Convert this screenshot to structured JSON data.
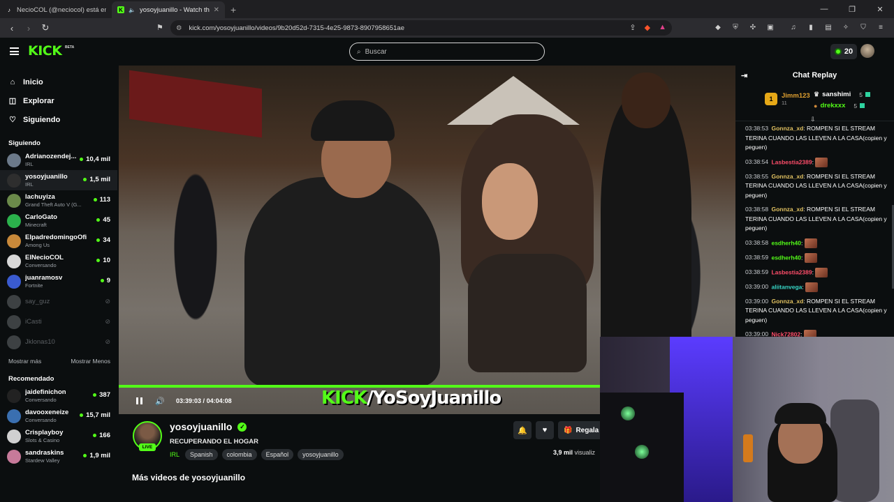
{
  "browser": {
    "tabs": [
      {
        "title": "NecioCOL (@neciocol) está emitiendo",
        "active": false
      },
      {
        "title": "yosoyjuanillo - Watch the VOD",
        "active": true
      }
    ],
    "url": "kick.com/yosoyjuanillo/videos/9b20d52d-7315-4e25-9873-8907958651ae"
  },
  "header": {
    "logo": "KICK",
    "beta": "BETA",
    "search_placeholder": "Buscar",
    "kicks_count": "20"
  },
  "nav": {
    "items": [
      {
        "label": "Inicio",
        "icon": "home-icon"
      },
      {
        "label": "Explorar",
        "icon": "compass-icon"
      },
      {
        "label": "Siguiendo",
        "icon": "heart-icon"
      }
    ]
  },
  "following": {
    "title": "Siguiendo",
    "channels": [
      {
        "name": "Adrianozendej...",
        "category": "IRL",
        "viewers": "10,4 mil",
        "live": true,
        "color": "#6c7a8a"
      },
      {
        "name": "yosoyjuanillo",
        "category": "IRL",
        "viewers": "1,5 mil",
        "live": true,
        "color": "#2e2e2e"
      },
      {
        "name": "lachuyiza",
        "category": "Grand Theft Auto V (G...",
        "viewers": "113",
        "live": true,
        "color": "#6b8a4a"
      },
      {
        "name": "CarloGato",
        "category": "Minecraft",
        "viewers": "45",
        "live": true,
        "color": "#2bb24c"
      },
      {
        "name": "ElpadredomingoOfi...",
        "category": "Among Us",
        "viewers": "34",
        "live": true,
        "color": "#c8893a"
      },
      {
        "name": "ElNecioCOL",
        "category": "Conversando",
        "viewers": "10",
        "live": true,
        "color": "#d8d8d8"
      },
      {
        "name": "juanramosv",
        "category": "Fortnite",
        "viewers": "9",
        "live": true,
        "color": "#3a5bd0"
      },
      {
        "name": "say_guz",
        "category": "",
        "viewers": "",
        "live": false,
        "color": "#9aa0a6"
      },
      {
        "name": "iCasti",
        "category": "",
        "viewers": "",
        "live": false,
        "color": "#9aa0a6"
      },
      {
        "name": "Jklonas10",
        "category": "",
        "viewers": "",
        "live": false,
        "color": "#9aa0a6"
      }
    ],
    "show_more": "Mostrar más",
    "show_less": "Mostrar Menos"
  },
  "recommended": {
    "title": "Recomendado",
    "channels": [
      {
        "name": "jaidefinichon",
        "category": "Conversando",
        "viewers": "387",
        "color": "#222"
      },
      {
        "name": "davooxeneize",
        "category": "Conversando",
        "viewers": "15,7 mil",
        "color": "#3a6fb0"
      },
      {
        "name": "Crisplayboy",
        "category": "Slots & Casino",
        "viewers": "166",
        "color": "#d0d0d0"
      },
      {
        "name": "sandraskins",
        "category": "Stardew Valley",
        "viewers": "1,9 mil",
        "color": "#c77a9a"
      }
    ]
  },
  "player": {
    "watermark_kick": "KICK",
    "watermark_name": "/YoSoyJuanillo",
    "current_time": "03:39:03",
    "separator": "/",
    "duration": "04:04:08",
    "progress": 0.8334
  },
  "channel": {
    "username": "yosoyjuanillo",
    "live_badge": "LIVE",
    "stream_title": "RECUPERANDO EL HOGAR",
    "category": "IRL",
    "tags": [
      "Spanish",
      "colombia",
      "Español",
      "yosoyjuanillo"
    ],
    "gift_label": "Regala",
    "views_count": "3,9 mil",
    "views_label": "visualiz",
    "more_videos": "Más videos de yosoyjuanillo"
  },
  "chat": {
    "title": "Chat Replay",
    "leaderboard": {
      "first": {
        "rank": "1",
        "name": "Jimm123",
        "count": "11"
      },
      "others": [
        {
          "name": "sanshimi",
          "count": "5",
          "color": "#ffffff"
        },
        {
          "name": "drekxxx",
          "count": "5",
          "color": "#53fc18"
        }
      ]
    },
    "messages": [
      {
        "time": "03:38:53",
        "user": "Gonnza_xd",
        "color": "#e0c060",
        "text": "ROMPEN SI EL STREAM TERINA CUANDO LAS LLEVEN A LA CASA(copien y peguen)",
        "emote": false
      },
      {
        "time": "03:38:54",
        "user": "Lasbestia2389",
        "color": "#ff4d6a",
        "text": "",
        "emote": true
      },
      {
        "time": "03:38:55",
        "user": "Gonnza_xd",
        "color": "#e0c060",
        "text": "ROMPEN SI EL STREAM TERINA CUANDO LAS LLEVEN A LA CASA(copien y peguen)",
        "emote": false
      },
      {
        "time": "03:38:58",
        "user": "Gonnza_xd",
        "color": "#e0c060",
        "text": "ROMPEN SI EL STREAM TERINA CUANDO LAS LLEVEN A LA CASA(copien y peguen)",
        "emote": false
      },
      {
        "time": "03:38:58",
        "user": "esdherh40",
        "color": "#53fc18",
        "text": "",
        "emote": true
      },
      {
        "time": "03:38:59",
        "user": "esdherh40",
        "color": "#53fc18",
        "text": "",
        "emote": true
      },
      {
        "time": "03:38:59",
        "user": "Lasbestia2389",
        "color": "#ff4d6a",
        "text": "",
        "emote": true
      },
      {
        "time": "03:39:00",
        "user": "aliitanvega",
        "color": "#37d6c6",
        "text": "",
        "emote": true
      },
      {
        "time": "03:39:00",
        "user": "Gonnza_xd",
        "color": "#e0c060",
        "text": "ROMPEN SI EL STREAM TERINA CUANDO LAS LLEVEN A LA CASA(copien y peguen)",
        "emote": false
      },
      {
        "time": "03:39:00",
        "user": "Nick72802",
        "color": "#ff4d6a",
        "text": "",
        "emote": true
      }
    ]
  },
  "colors": {
    "accent": "#53fc18",
    "background": "#0b0e0f"
  }
}
